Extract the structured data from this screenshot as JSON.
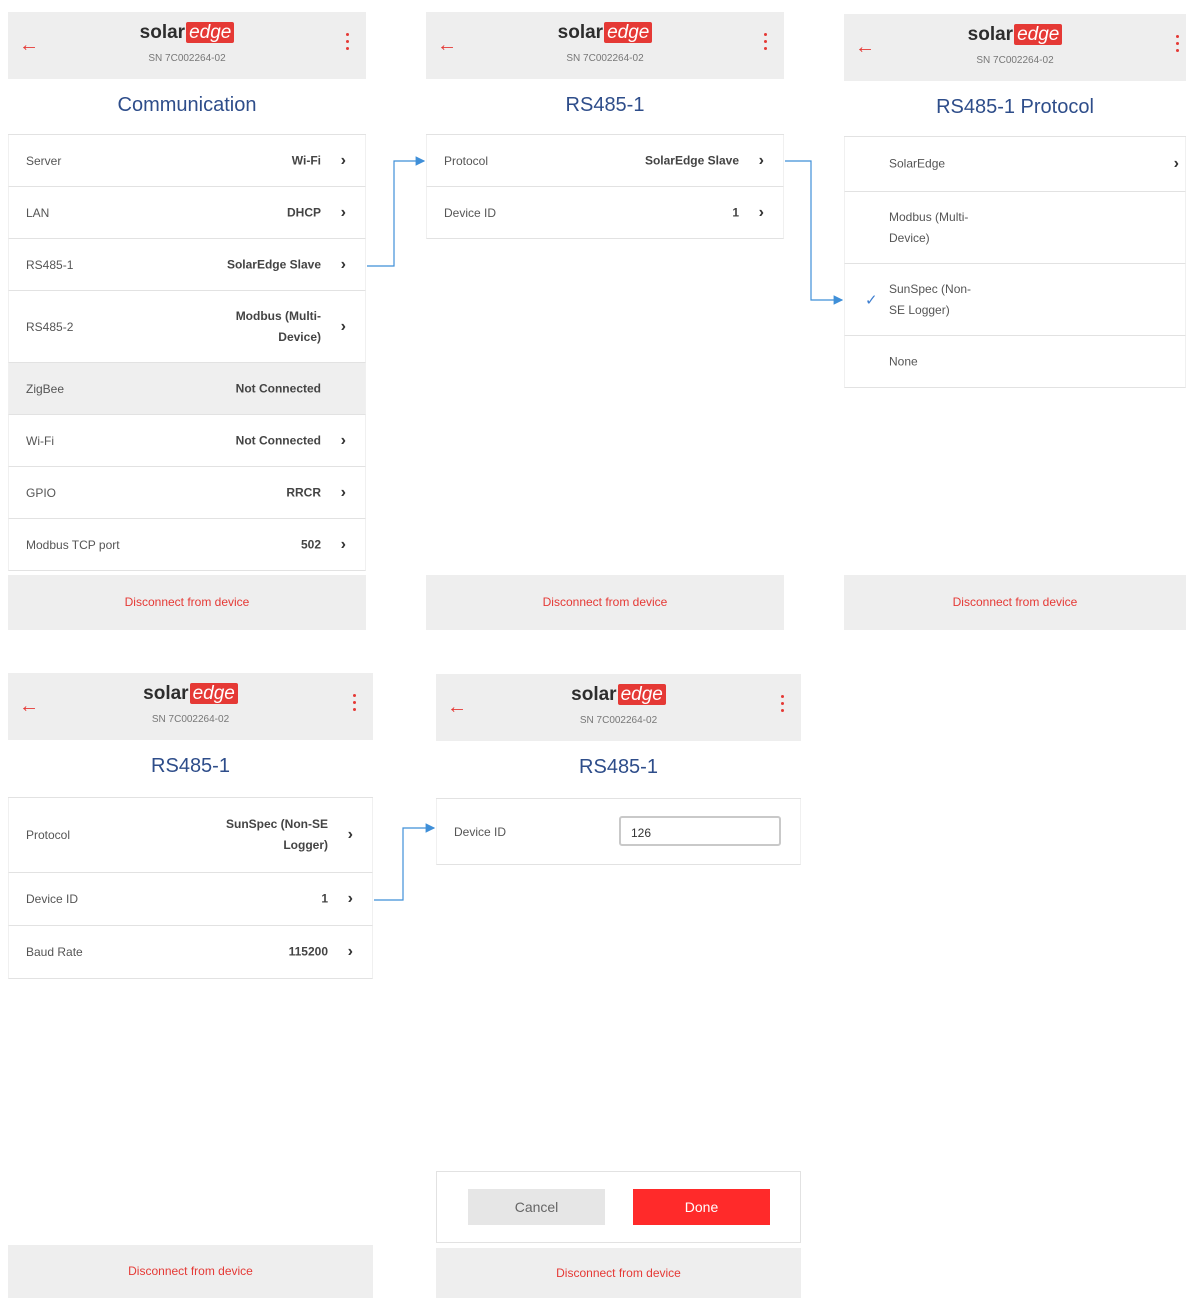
{
  "common": {
    "logo_left": "solar",
    "logo_right": "edge",
    "serial": "SN 7C002264-02",
    "back_icon": "←",
    "chevron": "›",
    "disconnect": "Disconnect from device"
  },
  "screen1": {
    "title": "Communication",
    "rows": [
      {
        "label": "Server",
        "value": "Wi-Fi"
      },
      {
        "label": "LAN",
        "value": "DHCP"
      },
      {
        "label": "RS485-1",
        "value": "SolarEdge Slave"
      },
      {
        "label": "RS485-2",
        "value_line1": "Modbus (Multi-",
        "value_line2": "Device)"
      },
      {
        "label": "ZigBee",
        "value": "Not Connected"
      },
      {
        "label": "Wi-Fi",
        "value": "Not Connected"
      },
      {
        "label": "GPIO",
        "value": "RRCR"
      },
      {
        "label": "Modbus TCP port",
        "value": "502"
      }
    ]
  },
  "screen2": {
    "title": "RS485-1",
    "rows": [
      {
        "label": "Protocol",
        "value": "SolarEdge Slave"
      },
      {
        "label": "Device ID",
        "value": "1"
      }
    ]
  },
  "screen3": {
    "title": "RS485-1 Protocol",
    "options": [
      {
        "line1": "SolarEdge",
        "line2": ""
      },
      {
        "line1": "Modbus (Multi-",
        "line2": "Device)"
      },
      {
        "line1": "SunSpec (Non-",
        "line2": "SE Logger)",
        "selected": true
      },
      {
        "line1": "None",
        "line2": ""
      }
    ],
    "check_icon": "✓"
  },
  "screen4": {
    "title": "RS485-1",
    "rows": [
      {
        "label": "Protocol",
        "value_line1": "SunSpec (Non-SE",
        "value_line2": "Logger)"
      },
      {
        "label": "Device ID",
        "value": "1"
      },
      {
        "label": "Baud Rate",
        "value": "115200"
      }
    ]
  },
  "screen5": {
    "title": "RS485-1",
    "device_id_label": "Device ID",
    "device_id_value": "126",
    "cancel": "Cancel",
    "done": "Done"
  },
  "colors": {
    "accent": "#e53935",
    "title_blue": "#2e4d8a",
    "arrow_blue": "#3f8fd8",
    "done_red": "#ff2a2a"
  }
}
